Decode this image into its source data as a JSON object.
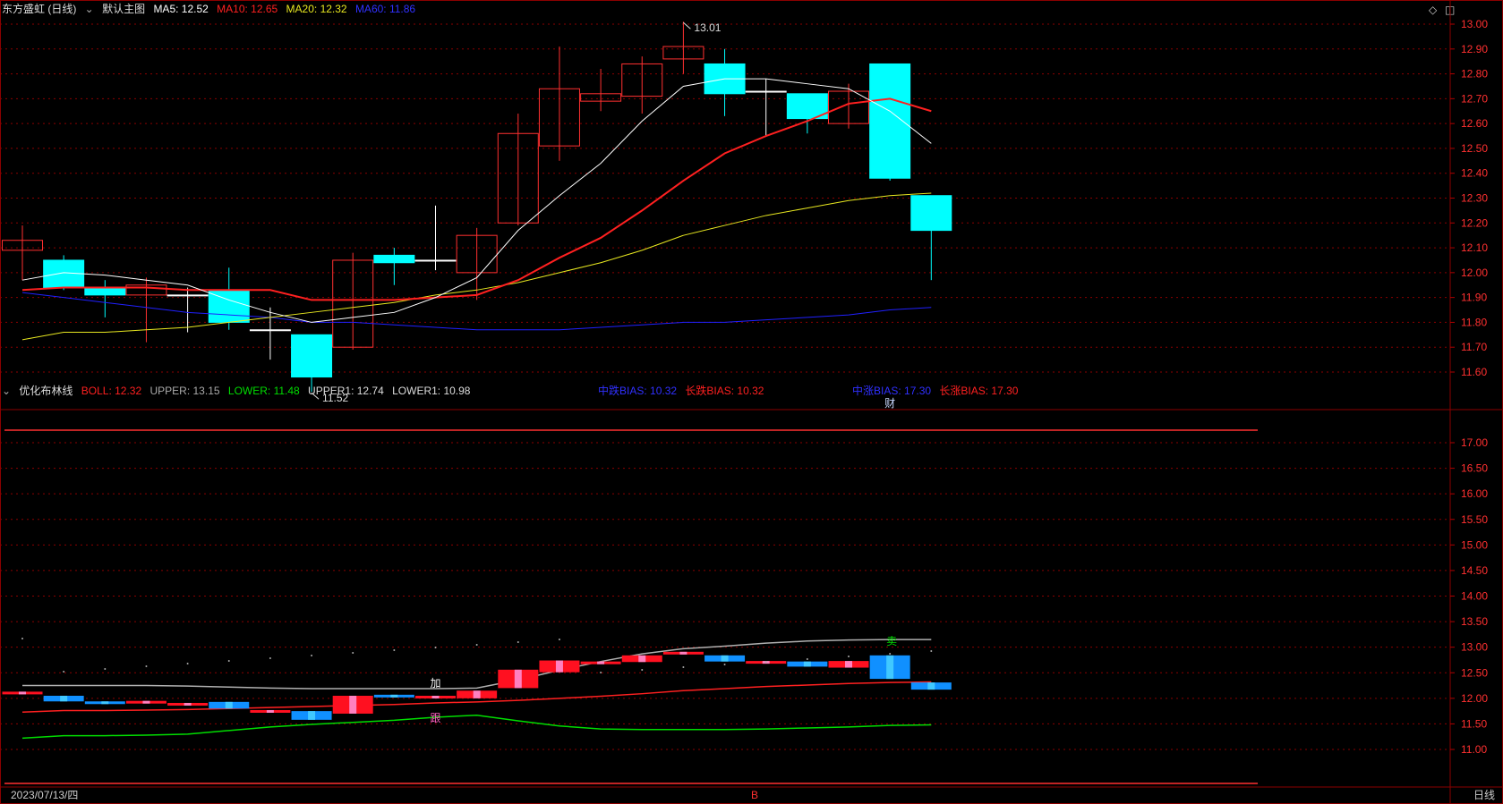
{
  "header": {
    "stock_name": "东方盛虹 (日线)",
    "main_chart_label": "默认主图",
    "ma5": "MA5: 12.52",
    "ma10": "MA10: 12.65",
    "ma20": "MA20: 12.32",
    "ma60": "MA60: 11.86"
  },
  "sub_header": {
    "indicator_name": "优化布林线",
    "boll": "BOLL: 12.32",
    "upper": "UPPER: 13.15",
    "lower": "LOWER: 11.48",
    "upper1": "UPPER1: 12.74",
    "lower1": "LOWER1: 10.98",
    "mid_bias": "中跌BIAS: 10.32",
    "long_bias": "长跌BIAS: 10.32",
    "mid_rise_bias": "中涨BIAS: 17.30",
    "long_rise_bias": "长涨BIAS: 17.30"
  },
  "footer": {
    "date": "2023/07/13/四",
    "marker": "B",
    "period": "日线"
  },
  "window_icons": {
    "diamond": "◇",
    "restore": "◫"
  },
  "colors": {
    "ma5": "#ffffff",
    "ma10": "#ff2020",
    "ma20": "#e8e820",
    "ma60": "#2020ff",
    "up": "#ff3030",
    "down": "#00ffff",
    "boll_upper": "#b0b0b0",
    "boll_mid": "#ff2020",
    "boll_lower": "#00dd00"
  },
  "chart_data": [
    {
      "type": "candlestick",
      "title": "东方盛虹 (日线)",
      "ylim": [
        11.52,
        13.01
      ],
      "yticks": [
        "13.00",
        "12.90",
        "12.80",
        "12.70",
        "12.60",
        "12.50",
        "12.40",
        "12.30",
        "12.20",
        "12.10",
        "12.00",
        "11.90",
        "11.80",
        "11.70",
        "11.60"
      ],
      "high_label": "13.01",
      "low_label": "11.52",
      "event_marker": "财",
      "candles": [
        {
          "o": 12.09,
          "h": 12.19,
          "l": 11.97,
          "c": 12.13
        },
        {
          "o": 12.05,
          "h": 12.07,
          "l": 11.93,
          "c": 11.94
        },
        {
          "o": 11.94,
          "h": 11.97,
          "l": 11.82,
          "c": 11.91
        },
        {
          "o": 11.91,
          "h": 11.98,
          "l": 11.72,
          "c": 11.95
        },
        {
          "o": 11.91,
          "h": 11.94,
          "l": 11.76,
          "c": 11.91
        },
        {
          "o": 11.93,
          "h": 12.02,
          "l": 11.77,
          "c": 11.8
        },
        {
          "o": 11.77,
          "h": 11.86,
          "l": 11.65,
          "c": 11.77
        },
        {
          "o": 11.75,
          "h": 11.75,
          "l": 11.52,
          "c": 11.58
        },
        {
          "o": 11.7,
          "h": 12.08,
          "l": 11.69,
          "c": 12.05
        },
        {
          "o": 12.07,
          "h": 12.1,
          "l": 11.95,
          "c": 12.04
        },
        {
          "o": 12.05,
          "h": 12.27,
          "l": 12.01,
          "c": 12.05
        },
        {
          "o": 12.0,
          "h": 12.18,
          "l": 11.89,
          "c": 12.15
        },
        {
          "o": 12.2,
          "h": 12.64,
          "l": 12.19,
          "c": 12.56
        },
        {
          "o": 12.51,
          "h": 12.91,
          "l": 12.45,
          "c": 12.74
        },
        {
          "o": 12.69,
          "h": 12.82,
          "l": 12.65,
          "c": 12.72
        },
        {
          "o": 12.71,
          "h": 12.87,
          "l": 12.64,
          "c": 12.84
        },
        {
          "o": 12.86,
          "h": 13.01,
          "l": 12.8,
          "c": 12.91
        },
        {
          "o": 12.84,
          "h": 12.9,
          "l": 12.63,
          "c": 12.72
        },
        {
          "o": 12.73,
          "h": 12.78,
          "l": 12.55,
          "c": 12.73
        },
        {
          "o": 12.72,
          "h": 12.72,
          "l": 12.56,
          "c": 12.62
        },
        {
          "o": 12.6,
          "h": 12.76,
          "l": 12.58,
          "c": 12.73
        },
        {
          "o": 12.84,
          "h": 12.84,
          "l": 12.37,
          "c": 12.38
        },
        {
          "o": 12.31,
          "h": 12.31,
          "l": 11.97,
          "c": 12.17
        }
      ],
      "ma5": [
        11.97,
        12.0,
        11.99,
        11.97,
        11.95,
        11.89,
        11.84,
        11.8,
        11.82,
        11.84,
        11.9,
        11.98,
        12.17,
        12.31,
        12.44,
        12.61,
        12.75,
        12.78,
        12.78,
        12.76,
        12.74,
        12.65,
        12.52
      ],
      "ma10": [
        11.93,
        11.94,
        11.94,
        11.94,
        11.93,
        11.93,
        11.93,
        11.89,
        11.89,
        11.89,
        11.9,
        11.91,
        11.97,
        12.06,
        12.14,
        12.25,
        12.37,
        12.48,
        12.55,
        12.61,
        12.68,
        12.7,
        12.65
      ],
      "ma20": [
        11.73,
        11.76,
        11.76,
        11.77,
        11.78,
        11.8,
        11.82,
        11.84,
        11.86,
        11.88,
        11.91,
        11.93,
        11.96,
        12.0,
        12.04,
        12.09,
        12.15,
        12.19,
        12.23,
        12.26,
        12.29,
        12.31,
        12.32
      ],
      "ma60": [
        11.92,
        11.9,
        11.88,
        11.86,
        11.84,
        11.83,
        11.82,
        11.8,
        11.8,
        11.79,
        11.78,
        11.77,
        11.77,
        11.77,
        11.78,
        11.79,
        11.8,
        11.8,
        11.81,
        11.82,
        11.83,
        11.85,
        11.86
      ]
    },
    {
      "type": "line",
      "title": "优化布林线",
      "ylim": [
        10.98,
        17.3
      ],
      "yticks": [
        "17.00",
        "16.50",
        "16.00",
        "15.50",
        "15.00",
        "14.50",
        "14.00",
        "13.50",
        "13.00",
        "12.50",
        "12.00",
        "11.50",
        "11.00"
      ],
      "series": [
        {
          "name": "UPPER",
          "values": [
            12.25,
            12.25,
            12.25,
            12.25,
            12.24,
            12.22,
            12.2,
            12.19,
            12.19,
            12.19,
            12.19,
            12.2,
            12.36,
            12.55,
            12.72,
            12.87,
            12.97,
            13.02,
            13.08,
            13.12,
            13.14,
            13.15,
            13.15
          ]
        },
        {
          "name": "BOLL",
          "values": [
            11.73,
            11.76,
            11.76,
            11.77,
            11.78,
            11.8,
            11.82,
            11.84,
            11.86,
            11.88,
            11.91,
            11.93,
            11.96,
            12.0,
            12.04,
            12.09,
            12.15,
            12.19,
            12.23,
            12.26,
            12.29,
            12.31,
            12.32
          ]
        },
        {
          "name": "LOWER",
          "values": [
            11.22,
            11.27,
            11.27,
            11.28,
            11.3,
            11.37,
            11.44,
            11.49,
            11.53,
            11.57,
            11.63,
            11.67,
            11.56,
            11.46,
            11.4,
            11.39,
            11.39,
            11.39,
            11.4,
            11.42,
            11.44,
            11.47,
            11.48
          ]
        },
        {
          "name": "UPPER1",
          "values": [
            12.74
          ]
        },
        {
          "name": "LOWER1",
          "values": [
            10.98
          ]
        }
      ],
      "annotations": [
        "加",
        "跟",
        "卖"
      ]
    }
  ]
}
